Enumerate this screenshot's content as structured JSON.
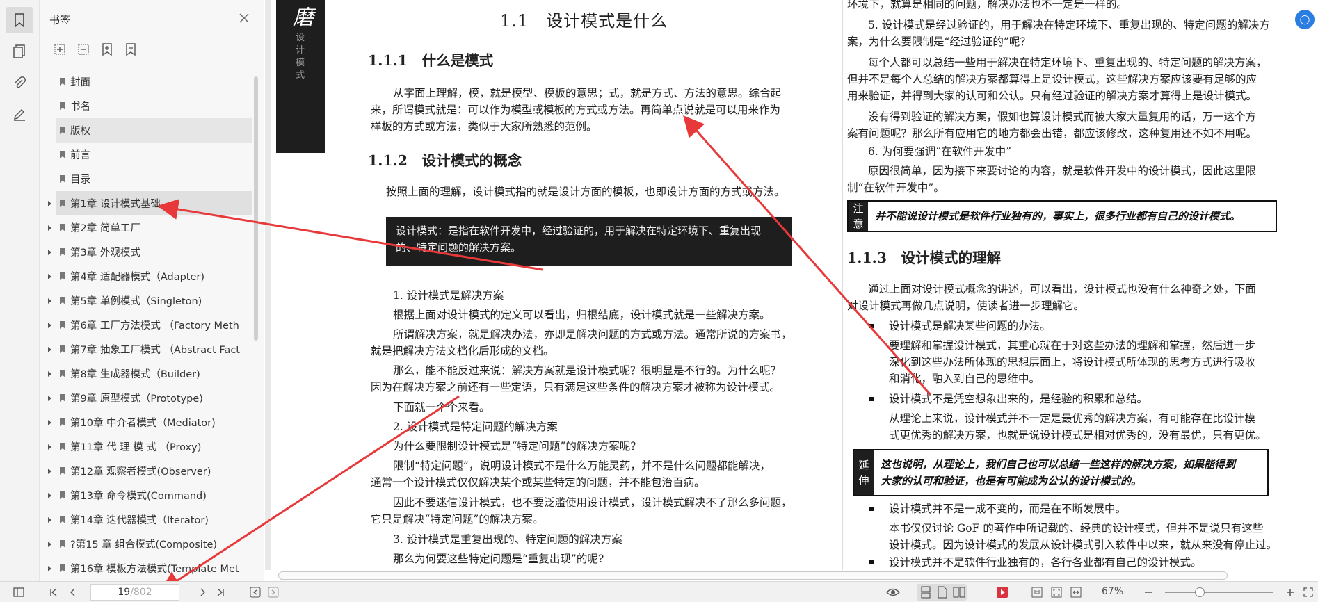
{
  "panel": {
    "title": "书签",
    "bookmarks": [
      {
        "label": "封面",
        "expandable": false
      },
      {
        "label": "书名",
        "expandable": false
      },
      {
        "label": "版权",
        "expandable": false
      },
      {
        "label": "前言",
        "expandable": false
      },
      {
        "label": "目录",
        "expandable": false
      },
      {
        "label": "第1章 设计模式基础",
        "expandable": true,
        "selected": true
      },
      {
        "label": "第2章 简单工厂",
        "expandable": true
      },
      {
        "label": "第3章 外观模式",
        "expandable": true
      },
      {
        "label": "第4章 适配器模式（Adapter)",
        "expandable": true
      },
      {
        "label": "第5章 单例模式（Singleton)",
        "expandable": true
      },
      {
        "label": "第6章 工厂方法模式 （Factory Meth",
        "expandable": true
      },
      {
        "label": "第7章 抽象工厂模式 （Abstract Fact",
        "expandable": true
      },
      {
        "label": "第8章 生成器模式（Builder)",
        "expandable": true
      },
      {
        "label": "第9章 原型模式（Prototype)",
        "expandable": true
      },
      {
        "label": "第10章 中介者模式（Mediator)",
        "expandable": true
      },
      {
        "label": "第11章 代 理 模 式 （Proxy)",
        "expandable": true
      },
      {
        "label": "第12章 观察者模式(Observer)",
        "expandable": true
      },
      {
        "label": "第13章 命令模式(Command)",
        "expandable": true
      },
      {
        "label": "第14章 迭代器模式（Iterator)",
        "expandable": true
      },
      {
        "label": "?第15 章 组合模式(Composite)",
        "expandable": true
      },
      {
        "label": "第16章 模板方法模式(Template Met",
        "expandable": true
      }
    ]
  },
  "left_page": {
    "side_title": "磨",
    "side_vertical": "设计模式",
    "h1": "1.1　设计模式是什么",
    "h2_a": "1.1.1　什么是模式",
    "p_a1": "从字面上理解，模，就是模型、模板的意思；式，就是方式、方法的意思。综合起",
    "p_a2": "来，所谓模式就是：可以作为模型或模板的方式或方法。再简单点说就是可以用来作为",
    "p_a3": "样板的方式或方法，类似于大家所熟悉的范例。",
    "h2_b": "1.1.2　设计模式的概念",
    "p_b1": "按照上面的理解，设计模式指的就是设计方面的模板，也即设计方面的方式或方法。",
    "def1": "设计模式：是指在软件开发中，经过验证的，用于解决在特定环境下、重复出现",
    "def2": "的、特定问题的解决方案。",
    "l1": "1. 设计模式是解决方案",
    "l2": "根据上面对设计模式的定义可以看出，归根结底，设计模式就是一些解决方案。",
    "l3": "所谓解决方案，就是解决办法，亦即是解决问题的方式或方法。通常所说的方案书，",
    "l4": "就是把解决方法文档化后形成的文档。",
    "l5": "那么，能不能反过来说：解决方案就是设计模式呢？很明显是不行的。为什么呢？",
    "l6": "因为在解决方案之前还有一些定语，只有满足这些条件的解决方案才被称为设计模式。",
    "l7": "下面就一个个来看。",
    "l8": "2. 设计模式是特定问题的解决方案",
    "l9": "为什么要限制设计模式是“特定问题”的解决方案呢？",
    "l10": "限制“特定问题”，说明设计模式不是什么万能灵药，并不是什么问题都能解决，",
    "l11": "通常一个设计模式仅仅解决某个或某些特定的问题，并不能包治百病。",
    "l12": "因此不要迷信设计模式，也不要泛滥使用设计模式，设计模式解决不了那么多问题，",
    "l13": "它只是解决“特定问题”的解决方案。",
    "l14": "3. 设计模式是重复出现的、特定问题的解决方案",
    "l15": "那么为何要这些特定问题是“重复出现”的呢?"
  },
  "right_page": {
    "r0": "环境下，就算是相同的问题，解决办法也不一定是一样的。",
    "r1": "5. 设计模式是经过验证的，用于解决在特定环境下、重复出现的、特定问题的解决方",
    "r2": "案，为什么要限制是“经过验证的”呢？",
    "r3": "每个人都可以总结一些用于解决在特定环境下、重复出现的、特定问题的解决方案，",
    "r4": "但并不是每个人总结的解决方案都算得上是设计模式，这些解决方案应该要有足够的应",
    "r5": "用来验证，并得到大家的认可和公认。只有经过验证的解决方案才算得上是设计模式。",
    "r6": "没有得到验证的解决方案，假如也算设计模式而被大家大量复用的话，万一这个方",
    "r7": "案有问题呢？那么所有应用它的地方都会出错，都应该修改，这种复用还不如不用呢。",
    "r8": "6. 为何要强调“在软件开发中”",
    "r9": "原因很简单，因为接下来要讨论的内容，就是软件开发中的设计模式，因此这里限",
    "r10": "制“在软件开发中”。",
    "note1_tag": "注意",
    "note1": "并不能说设计模式是软件行业独有的，事实上，很多行业都有自己的设计模式。",
    "h2_c": "1.1.3　设计模式的理解",
    "r11": "通过上面对设计模式概念的讲述，可以看出，设计模式也没有什么神奇之处，下面",
    "r12": "对设计模式再做几点说明，使读者进一步理解它。",
    "b1": "设计模式是解决某些问题的办法。",
    "b1a": "要理解和掌握设计模式，其重心就在于对这些办法的理解和掌握，然后进一步",
    "b1b": "深化到这些办法所体现的思想层面上，将设计模式所体现的思考方式进行吸收",
    "b1c": "和消化，融入到自己的思维中。",
    "b2": "设计模式不是凭空想象出来的，是经验的积累和总结。",
    "b2a": "从理论上来说，设计模式并不一定是最优秀的解决方案，有可能存在比设计模",
    "b2b": "式更优秀的解决方案，也就是说设计模式是相对优秀的，没有最优，只有更优。",
    "note2_tag": "延伸",
    "note2a": "这也说明，从理论上，我们自己也可以总结一些这样的解决方案，如果能得到",
    "note2b": "大家的认可和验证，也是有可能成为公认的设计模式的。",
    "b3": "设计模式并不是一成不变的，而是在不断发展中。",
    "b3a": "本书仅仅讨论 GoF 的著作中所记载的、经典的设计模式，但并不是说只有这些",
    "b3b": "设计模式。因为设计模式的发展从设计模式引入软件中以来，就从来没有停止过。",
    "b4": "设计模式并不是软件行业独有的，各行各业都有自己的设计模式。"
  },
  "status": {
    "page_current": "19",
    "page_total": "/802",
    "zoom": "67%"
  },
  "colors": {
    "arrow": "#e8393a",
    "accent": "#2a7de1",
    "play": "#d9333f"
  }
}
